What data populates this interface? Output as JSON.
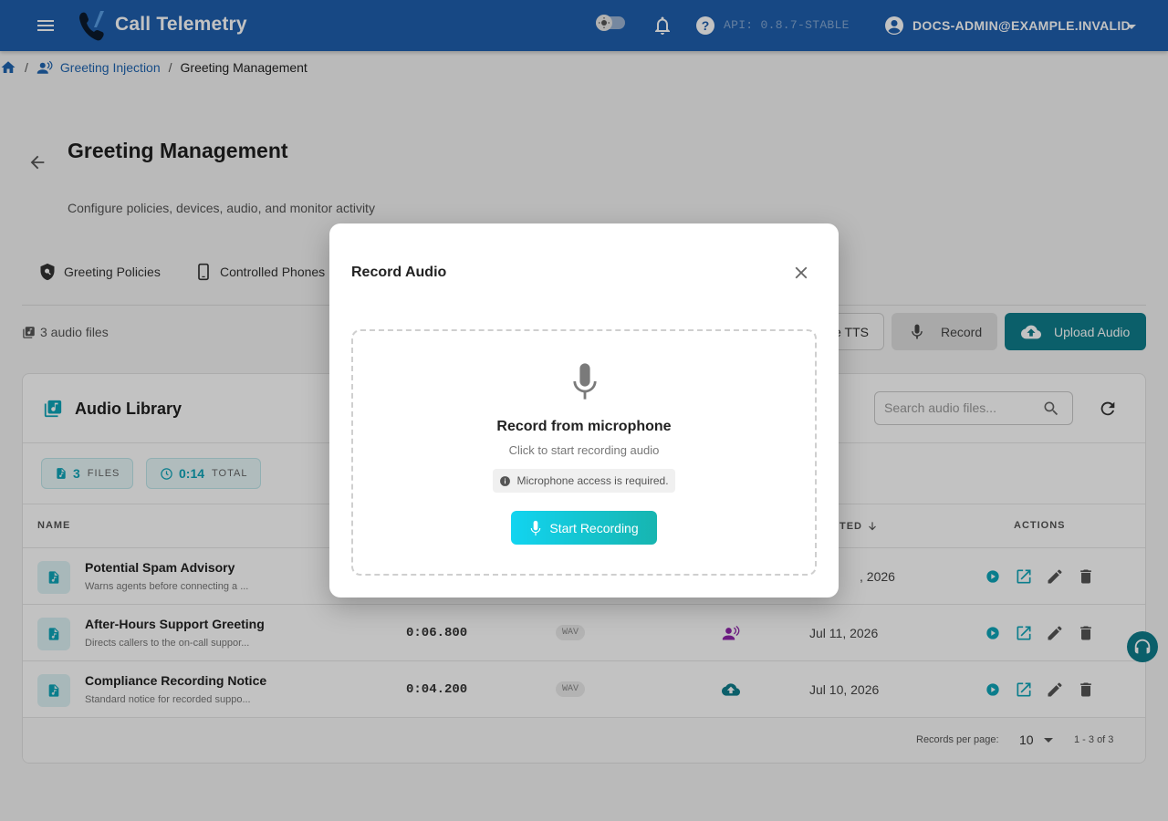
{
  "topbar": {
    "app_title": "Call Telemetry",
    "api_version": "API: 0.8.7-STABLE",
    "account_name": "DOCS-ADMIN@EXAMPLE.INVALID"
  },
  "breadcrumb": {
    "parent": "Greeting Injection",
    "current": "Greeting Management"
  },
  "page": {
    "title": "Greeting Management",
    "subtitle": "Configure policies, devices, audio, and monitor activity"
  },
  "tabs": [
    {
      "label": "Greeting Policies"
    },
    {
      "label": "Controlled Phones"
    }
  ],
  "toolbar": {
    "files_count": "3 audio files",
    "tts_label": "e TTS",
    "record_label": "Record",
    "upload_label": "Upload Audio"
  },
  "library": {
    "title": "Audio Library",
    "search_placeholder": "Search audio files...",
    "stats": {
      "files_num": "3",
      "files_label": "FILES",
      "total_num": "0:14",
      "total_label": "TOTAL"
    },
    "columns": {
      "name": "NAME",
      "created": "TED",
      "actions": "ACTIONS"
    },
    "rows": [
      {
        "name": "Potential Spam Advisory",
        "desc": "Warns agents before connecting a ...",
        "duration": "",
        "format": "",
        "source": "",
        "date": ", 2026"
      },
      {
        "name": "After-Hours Support Greeting",
        "desc": "Directs callers to the on-call suppor...",
        "duration": "0:06.800",
        "format": "WAV",
        "source": "voice",
        "date": "Jul 11, 2026"
      },
      {
        "name": "Compliance Recording Notice",
        "desc": "Standard notice for recorded suppo...",
        "duration": "0:04.200",
        "format": "WAV",
        "source": "upload",
        "date": "Jul 10, 2026"
      }
    ],
    "footer": {
      "rpp_label": "Records per page:",
      "rpp_value": "10",
      "range": "1 - 3 of 3"
    }
  },
  "modal": {
    "title": "Record Audio",
    "heading": "Record from microphone",
    "subtext": "Click to start recording audio",
    "note": "Microphone access is required.",
    "start_label": "Start Recording"
  },
  "colors": {
    "topbar": "#1f5fae",
    "teal": "#0f7d8c",
    "accent": "#0ea5b8",
    "purple": "#8e24aa"
  }
}
